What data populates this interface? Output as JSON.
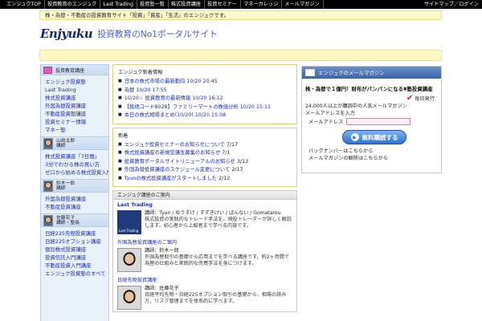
{
  "topnav": {
    "items": [
      "エンジュクTOP",
      "投資教育のエンジュク",
      "Last Trading",
      "投資塾一覧",
      "株式投資講座",
      "投資セミナー",
      "マネーカレッジ",
      "メールマガジン"
    ],
    "right": "サイトマップ／ログイン"
  },
  "notice": "株・為替・不動産の投資教育サイト「投資」「資産」「生活」のエンジュクです。",
  "logo": {
    "mark": "Enjyuku",
    "tagline": "投資教育のNo1ポータルサイト"
  },
  "left": {
    "header": "投資教育講座",
    "menu": [
      "エンジュク投資塾",
      "Last Trading",
      "株式投資講座",
      "外国為替投資講座",
      "不動産投資塾講座",
      "投資セミナー情報",
      "マネー塾"
    ],
    "prof1": {
      "name": "山田太郎",
      "role": "講師"
    },
    "menu2": [
      "株式投資講座「7日間」",
      "3分でわかる株の買い方",
      "ゼロから始める株式投資入門講座"
    ],
    "prof2": {
      "name": "鈴木一郎",
      "role": "講師"
    },
    "menu3": [
      "外国為替投資講座",
      "不動産投資講座"
    ],
    "prof3": {
      "name": "佐藤花子",
      "role": "講師・塾長"
    },
    "menu4": [
      "日経225先物投資講座",
      "日経225オプション講座",
      "個別株式投資講座",
      "投資信託入門講座",
      "不動産投資入門講座",
      "エンジュク投資塾のすべて"
    ]
  },
  "news": {
    "title": "エンジュク新着情報",
    "items": [
      {
        "text": "日本の株式市場の最新動向",
        "date": "10/20 20:45"
      },
      {
        "text": "為替",
        "date": "10/20 17:55"
      },
      {
        "text": "10/20☆",
        "date": "投資教育の最新情報 10/20 16:12"
      },
      {
        "text": "【銘柄コード8028】ファミリーマートの株価分析",
        "date": "10/20 15:11"
      },
      {
        "text": "本日の株式相場まとめ(10/20)",
        "date": "10/20 15:08"
      }
    ]
  },
  "info": {
    "title": "新着",
    "items": [
      {
        "text": "エンジュク投資セミナーのお知らせについて",
        "date": "7/17"
      },
      {
        "text": "株式投資講座の新規受講生募集のお知らせ",
        "date": "7/1"
      },
      {
        "text": "投資教育ポータルサイトリニューアルのお知らせ",
        "date": "3/13"
      },
      {
        "text": "外国為替投資講座のスケジュール変更について",
        "date": "2/17"
      },
      {
        "text": "Tyunの株式投資講座がスタートしました",
        "date": "2/12"
      }
    ]
  },
  "lessons": {
    "header": "エンジュク講座のご案内",
    "entry1": {
      "section": "Last Trading",
      "thumb": "Last Trading",
      "meta": "講師：Tyun / ゆうすけ / すずきけい / ばんない / Gomatarou",
      "desc": "株式投資の実践的なトレード手法を、現役トレーダーが詳しく解説します。初心者から上級者まで学べる内容です。"
    },
    "entry2": {
      "section": "外国為替投資講座のご案内",
      "meta": "講師：鈴木一郎",
      "desc": "外国為替取引の基礎から応用までを学べる講座です。約2ヶ月間で為替の仕組みと実践的な売買手法を身につけます。"
    },
    "entry3": {
      "section": "日経先物投資講座",
      "meta": "講師：佐藤花子",
      "desc": "日経平均先物・日経225オプション取引の基礎から、相場の読み方、リスク管理までを体系的に学べます。"
    }
  },
  "magazine": {
    "header": "エンジュクのメールマガジン",
    "title": "株・為替で１億円！財布がパンパンになる¥塾投資講座",
    "daily": "毎日発行",
    "readers": "24,000人以上が購読中の人気メールマガジン",
    "email_label": "メールアドレスを入力",
    "email_field": "メールアドレス",
    "button": "無料購読する",
    "foot1": "バックナンバーはこちらから",
    "foot2": "メールマガジンの解除はこちらから"
  }
}
